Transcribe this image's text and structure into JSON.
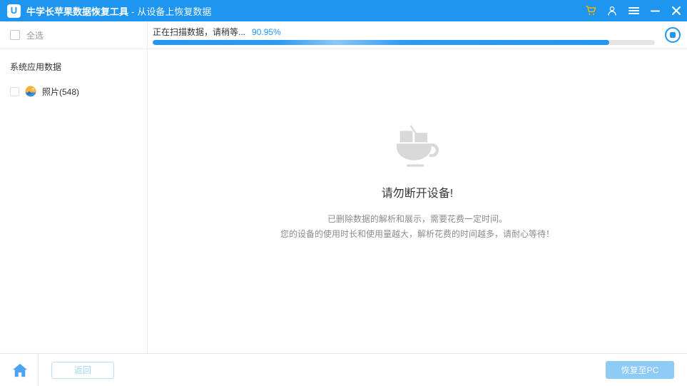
{
  "titlebar": {
    "app_name": "牛学长苹果数据恢复工具",
    "separator": "-",
    "context_title": "从设备上恢复数据",
    "logo_letter": "U",
    "icons": [
      "cart-icon",
      "user-icon",
      "menu-icon",
      "minimize-icon",
      "close-icon"
    ],
    "colors": {
      "bar": "#1e95ef",
      "cart": "#f7b500"
    }
  },
  "sidebar": {
    "select_all_label": "全选",
    "select_all_checked": false,
    "section_label": "系统应用数据",
    "items": [
      {
        "label": "照片(548)",
        "icon": "photo-icon",
        "checked": false
      }
    ]
  },
  "scan": {
    "status_text": "正在扫描数据，请稍等...",
    "percent_label": "90.95%",
    "percent_value": 90.95,
    "stop_icon": "stop-icon",
    "accent_color": "#2196f3"
  },
  "content": {
    "icon": "coffee-cup-icon",
    "title": "请勿断开设备!",
    "description_line1": "已删除数据的解析和展示，需要花费一定时间。",
    "description_line2": "您的设备的使用时长和使用量越大，解析花费的时间越多，请耐心等待！"
  },
  "footer": {
    "home_icon": "home-icon",
    "back_label": "返回",
    "recover_label": "恢复至PC",
    "disabled_button_color": "#8ecbf5"
  }
}
